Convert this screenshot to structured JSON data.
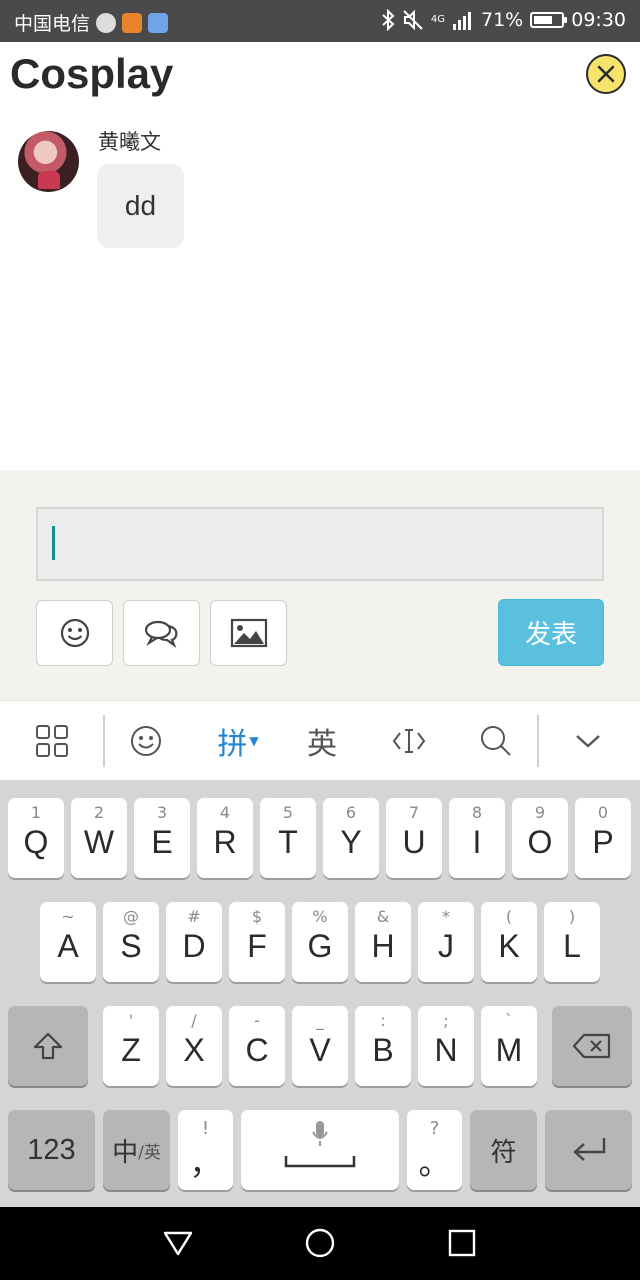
{
  "status_bar": {
    "carrier": "中国电信",
    "signal_label": "4G",
    "battery": "71%",
    "battery_level": 0.71,
    "time": "09:30"
  },
  "header": {
    "title": "Cosplay"
  },
  "message": {
    "sender": "黄曦文",
    "text": "dd"
  },
  "composer": {
    "input_value": "",
    "send_label": "发表"
  },
  "ime_toolbar": {
    "pinyin_label": "拼",
    "english_label": "英"
  },
  "keyboard": {
    "row1": [
      {
        "hint": "1",
        "label": "Q"
      },
      {
        "hint": "2",
        "label": "W"
      },
      {
        "hint": "3",
        "label": "E"
      },
      {
        "hint": "4",
        "label": "R"
      },
      {
        "hint": "5",
        "label": "T"
      },
      {
        "hint": "6",
        "label": "Y"
      },
      {
        "hint": "7",
        "label": "U"
      },
      {
        "hint": "8",
        "label": "I"
      },
      {
        "hint": "9",
        "label": "O"
      },
      {
        "hint": "0",
        "label": "P"
      }
    ],
    "row2": [
      {
        "hint": "~",
        "label": "A"
      },
      {
        "hint": "@",
        "label": "S"
      },
      {
        "hint": "#",
        "label": "D"
      },
      {
        "hint": "$",
        "label": "F"
      },
      {
        "hint": "%",
        "label": "G"
      },
      {
        "hint": "&",
        "label": "H"
      },
      {
        "hint": "*",
        "label": "J"
      },
      {
        "hint": "(",
        "label": "K"
      },
      {
        "hint": ")",
        "label": "L"
      }
    ],
    "row3": [
      {
        "hint": "'",
        "label": "Z"
      },
      {
        "hint": "/",
        "label": "X"
      },
      {
        "hint": "-",
        "label": "C"
      },
      {
        "hint": "_",
        "label": "V"
      },
      {
        "hint": ":",
        "label": "B"
      },
      {
        "hint": ";",
        "label": "N"
      },
      {
        "hint": "`",
        "label": "M"
      }
    ],
    "numbers_label": "123",
    "lang_label_main": "中",
    "lang_label_sub": "/英",
    "comma_hint": "!",
    "comma_label": "，",
    "period_hint": "?",
    "period_label": "。",
    "symbols_label": "符"
  }
}
